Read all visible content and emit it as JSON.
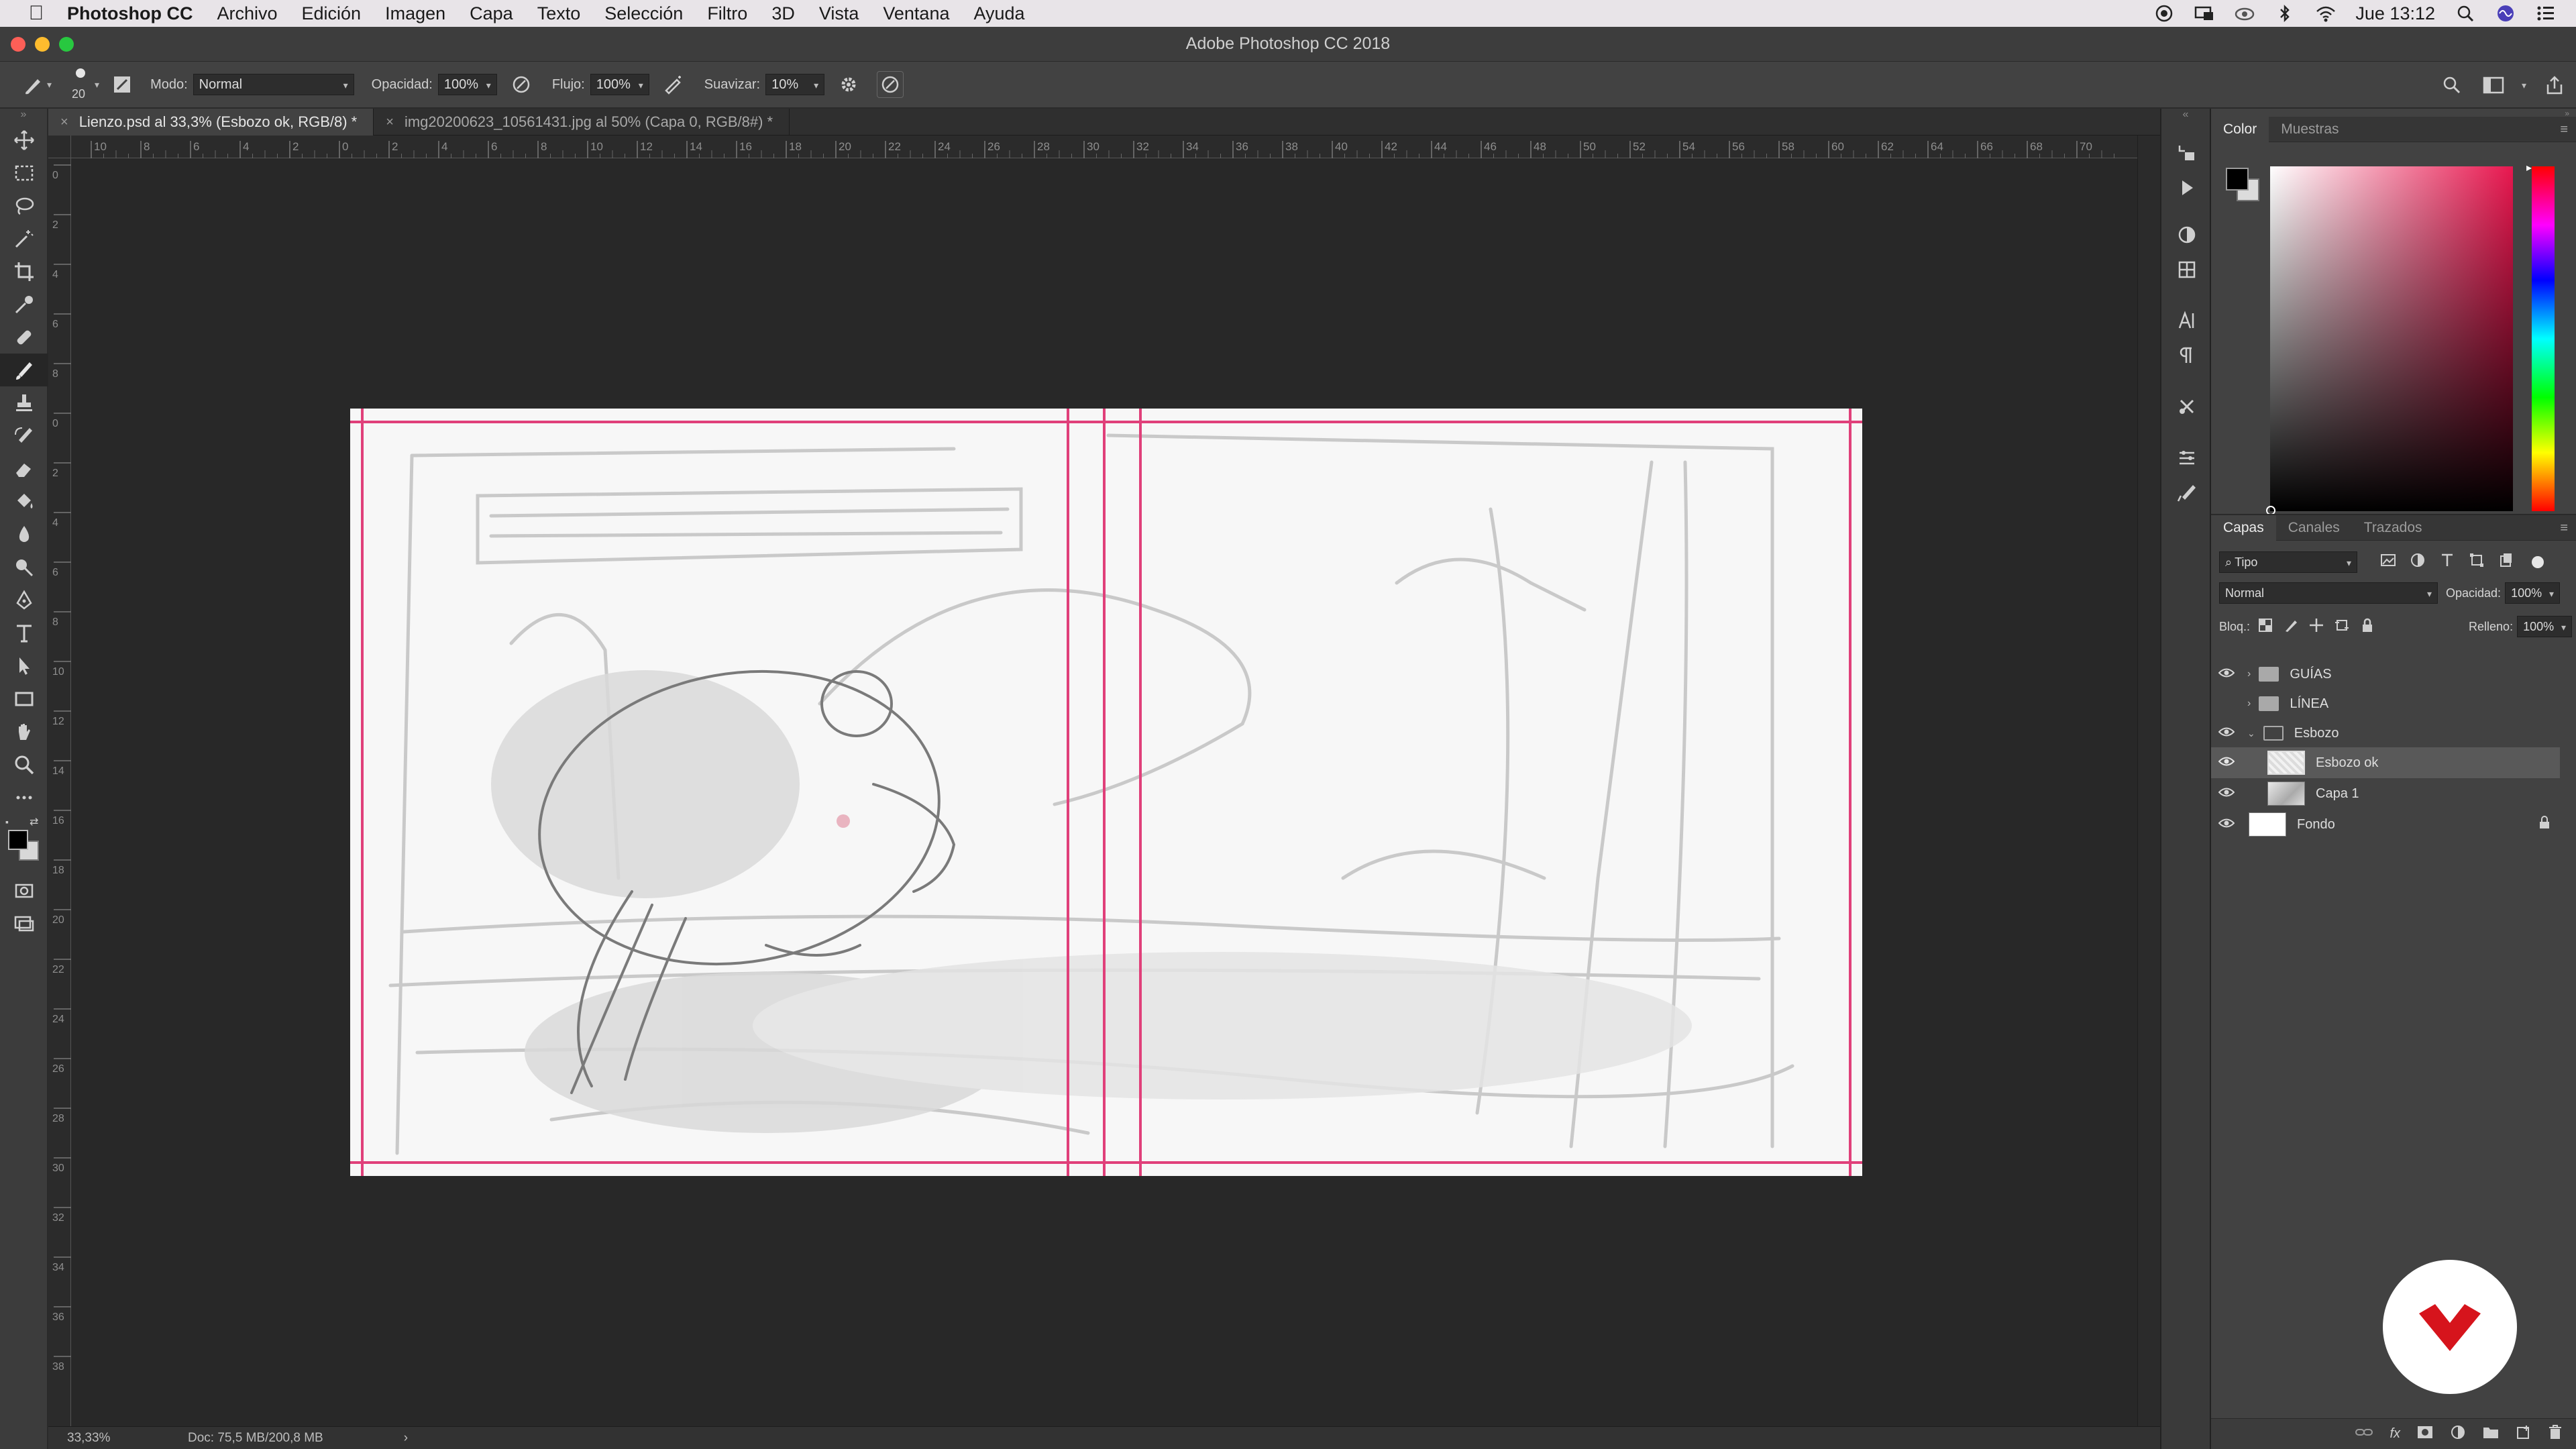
{
  "menubar": {
    "apple_icon": "apple-icon",
    "app_name": "Photoshop CC",
    "menus": [
      "Archivo",
      "Edición",
      "Imagen",
      "Capa",
      "Texto",
      "Selección",
      "Filtro",
      "3D",
      "Vista",
      "Ventana",
      "Ayuda"
    ],
    "clock": "Jue 13:12"
  },
  "window": {
    "title": "Adobe Photoshop CC 2018"
  },
  "options": {
    "brush_size": "20",
    "modo_label": "Modo:",
    "modo_value": "Normal",
    "opacidad_label": "Opacidad:",
    "opacidad_value": "100%",
    "flujo_label": "Flujo:",
    "flujo_value": "100%",
    "suavizar_label": "Suavizar:",
    "suavizar_value": "10%"
  },
  "tabs": [
    {
      "label": "Lienzo.psd al 33,3% (Esbozo ok, RGB/8) *",
      "active": true
    },
    {
      "label": "img20200623_10561431.jpg al 50% (Capa 0, RGB/8#) *",
      "active": false
    }
  ],
  "ruler": {
    "top_labels": [
      "10",
      "8",
      "6",
      "4",
      "2",
      "0",
      "2",
      "4",
      "6",
      "8",
      "10",
      "12",
      "14",
      "16",
      "18",
      "20",
      "22",
      "24",
      "26",
      "28",
      "30",
      "32",
      "34",
      "36",
      "38",
      "40",
      "42",
      "44",
      "46",
      "48",
      "50",
      "52",
      "54",
      "56",
      "58",
      "60",
      "62",
      "64",
      "66",
      "68",
      "70"
    ],
    "left_labels": [
      "0",
      "2",
      "4",
      "6",
      "8",
      "0",
      "2",
      "4",
      "6",
      "8",
      "10",
      "12",
      "14",
      "16",
      "18",
      "20",
      "22",
      "24",
      "26",
      "28",
      "30",
      "32",
      "34",
      "36",
      "38"
    ]
  },
  "status": {
    "zoom": "33,33%",
    "doc": "Doc: 75,5 MB/200,8 MB",
    "arrow": "›"
  },
  "color_panel": {
    "tabs": [
      "Color",
      "Muestras"
    ]
  },
  "layers_panel": {
    "tabs": [
      "Capas",
      "Canales",
      "Trazados"
    ],
    "filter_label": "Tipo",
    "blend_mode": "Normal",
    "opacity_label": "Opacidad:",
    "opacity_value": "100%",
    "lock_label": "Bloq.:",
    "fill_label": "Relleno:",
    "fill_value": "100%",
    "layers": [
      {
        "name": "GUÍAS",
        "kind": "group",
        "visible": true,
        "expanded": false
      },
      {
        "name": "LÍNEA",
        "kind": "group",
        "visible": false,
        "expanded": false
      },
      {
        "name": "Esbozo",
        "kind": "group",
        "visible": true,
        "expanded": true
      },
      {
        "name": "Esbozo ok",
        "kind": "layer",
        "visible": true,
        "selected": true
      },
      {
        "name": "Capa 1",
        "kind": "layer",
        "visible": true
      },
      {
        "name": "Fondo",
        "kind": "layer",
        "visible": true,
        "locked": true
      }
    ]
  },
  "colors": {
    "guide": "#e0407a",
    "accent_logo": "#d6141c"
  }
}
